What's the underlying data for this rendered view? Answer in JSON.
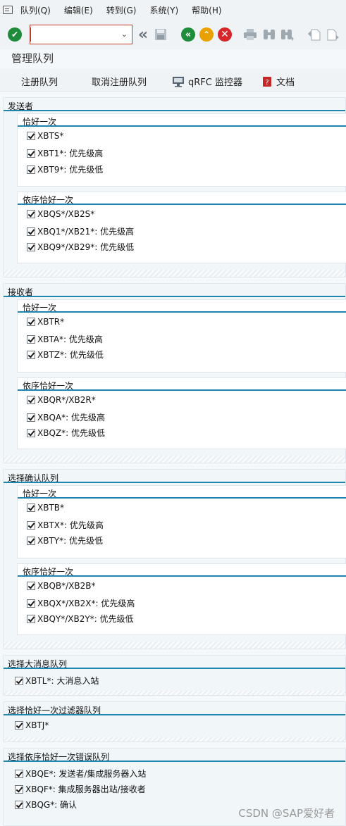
{
  "menu": [
    "队列(Q)",
    "编辑(E)",
    "转到(G)",
    "系统(Y)",
    "帮助(H)"
  ],
  "toolbar": {
    "command_value": "",
    "icons": [
      "check-icon",
      "back-icon",
      "save-icon",
      "nav-back-icon",
      "exit-icon",
      "cancel-icon",
      "print-icon",
      "find-icon",
      "find-next-icon",
      "first-page-icon",
      "next-page-icon"
    ]
  },
  "page_title": "管理队列",
  "app_toolbar": {
    "register": "注册队列",
    "deregister": "取消注册队列",
    "qrfc": "qRFC 监控器",
    "doc": "文档"
  },
  "groups": {
    "sender": {
      "title": "发送者",
      "eo": {
        "title": "恰好一次",
        "items": [
          "XBTS*",
          "XBT1*: 优先级高",
          "XBT9*: 优先级低"
        ]
      },
      "eoio": {
        "title": "依序恰好一次",
        "items": [
          "XBQS*/XB2S*",
          "XBQ1*/XB21*: 优先级高",
          "XBQ9*/XB29*: 优先级低"
        ]
      }
    },
    "receiver": {
      "title": "接收者",
      "eo": {
        "title": "恰好一次",
        "items": [
          "XBTR*",
          "XBTA*: 优先级高",
          "XBTZ*: 优先级低"
        ]
      },
      "eoio": {
        "title": "依序恰好一次",
        "items": [
          "XBQR*/XB2R*",
          "XBQA*: 优先级高",
          "XBQZ*: 优先级低"
        ]
      }
    },
    "ack": {
      "title": "选择确认队列",
      "eo": {
        "title": "恰好一次",
        "items": [
          "XBTB*",
          "XBTX*: 优先级高",
          "XBTY*: 优先级低"
        ]
      },
      "eoio": {
        "title": "依序恰好一次",
        "items": [
          "XBQB*/XB2B*",
          "XBQX*/XB2X*: 优先级高",
          "XBQY*/XB2Y*: 优先级低"
        ]
      }
    },
    "large": {
      "title": "选择大消息队列",
      "items": [
        "XBTL*: 大消息入站"
      ]
    },
    "filter": {
      "title": "选择恰好一次过滤器队列",
      "items": [
        "XBTJ*"
      ]
    },
    "error": {
      "title": "选择依序恰好一次错误队列",
      "items": [
        "XBQE*: 发送者/集成服务器入站",
        "XBQF*: 集成服务器出站/接收者",
        "XBQG*: 确认"
      ]
    }
  },
  "watermark": "CSDN @SAP爱好者"
}
